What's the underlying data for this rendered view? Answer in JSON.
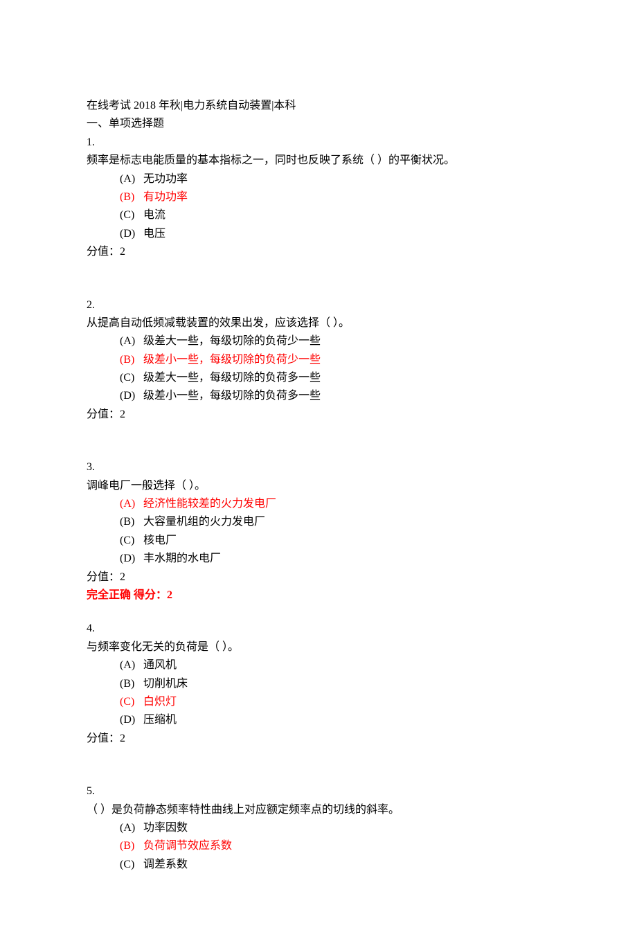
{
  "header": {
    "title": "在线考试 2018 年秋|电力系统自动装置|本科",
    "section": "一、单项选择题"
  },
  "questions": [
    {
      "num": "1.",
      "stem": "频率是标志电能质量的基本指标之一，同时也反映了系统（ ）的平衡状况。",
      "options": [
        {
          "label": "(A)",
          "text": "无功功率",
          "correct": false
        },
        {
          "label": "(B)",
          "text": "有功功率",
          "correct": true
        },
        {
          "label": "(C)",
          "text": "电流",
          "correct": false
        },
        {
          "label": "(D)",
          "text": "电压",
          "correct": false
        }
      ],
      "score": "分值：2",
      "result": ""
    },
    {
      "num": "2.",
      "stem": "从提高自动低频减载装置的效果出发，应该选择（ ）。",
      "options": [
        {
          "label": "(A)",
          "text": "级差大一些，每级切除的负荷少一些",
          "correct": false
        },
        {
          "label": "(B)",
          "text": "级差小一些，每级切除的负荷少一些",
          "correct": true
        },
        {
          "label": "(C)",
          "text": "级差大一些，每级切除的负荷多一些",
          "correct": false
        },
        {
          "label": "(D)",
          "text": "级差小一些，每级切除的负荷多一些",
          "correct": false
        }
      ],
      "score": "分值：2",
      "result": ""
    },
    {
      "num": "3.",
      "stem": "调峰电厂一般选择（ ）。",
      "options": [
        {
          "label": "(A)",
          "text": "经济性能较差的火力发电厂",
          "correct": true
        },
        {
          "label": "(B)",
          "text": "大容量机组的火力发电厂",
          "correct": false
        },
        {
          "label": "(C)",
          "text": "核电厂",
          "correct": false
        },
        {
          "label": "(D)",
          "text": "丰水期的水电厂",
          "correct": false
        }
      ],
      "score": "分值：2",
      "result": "完全正确 得分：2"
    },
    {
      "num": "4.",
      "stem": "与频率变化无关的负荷是（ ）。",
      "options": [
        {
          "label": "(A)",
          "text": "通风机",
          "correct": false
        },
        {
          "label": "(B)",
          "text": "切削机床",
          "correct": false
        },
        {
          "label": "(C)",
          "text": "白炽灯",
          "correct": true
        },
        {
          "label": "(D)",
          "text": "压缩机",
          "correct": false
        }
      ],
      "score": "分值：2",
      "result": ""
    },
    {
      "num": "5.",
      "stem": "（ ）是负荷静态频率特性曲线上对应额定频率点的切线的斜率。",
      "options": [
        {
          "label": "(A)",
          "text": "功率因数",
          "correct": false
        },
        {
          "label": "(B)",
          "text": "负荷调节效应系数",
          "correct": true
        },
        {
          "label": "(C)",
          "text": "调差系数",
          "correct": false
        }
      ],
      "score": "",
      "result": ""
    }
  ]
}
